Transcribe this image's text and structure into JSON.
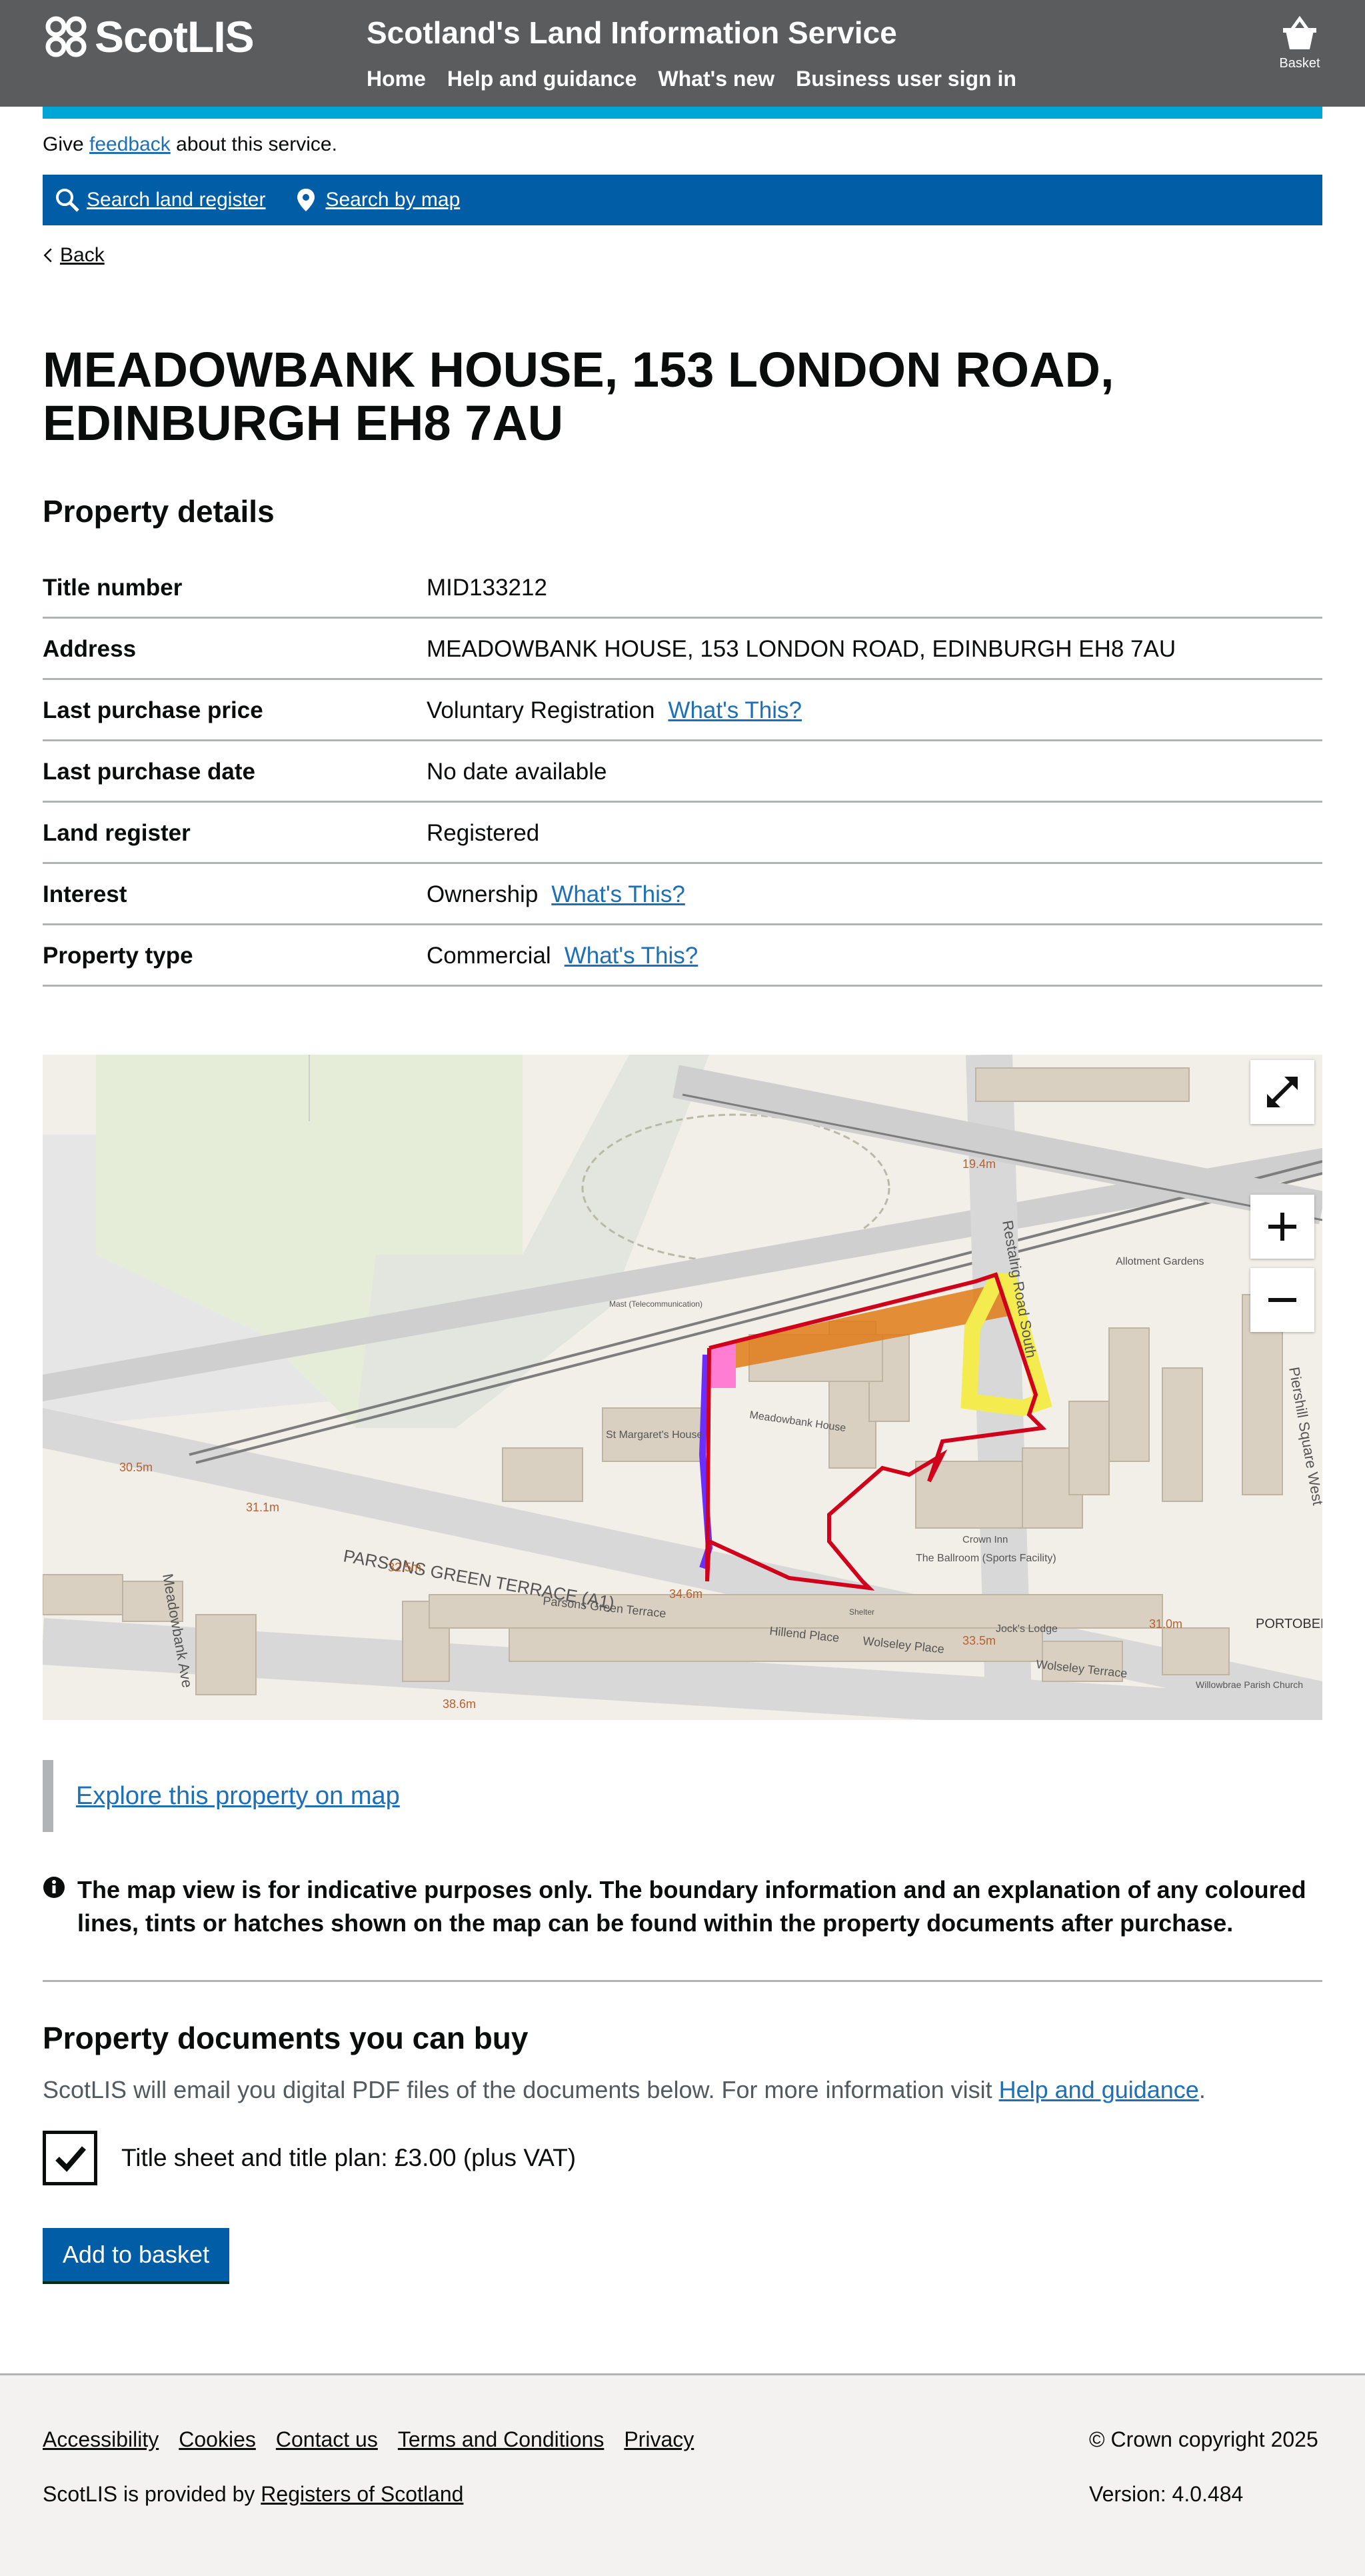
{
  "header": {
    "logo_text": "ScotLIS",
    "service_name": "Scotland's Land Information Service",
    "nav": [
      "Home",
      "Help and guidance",
      "What's new",
      "Business user sign in"
    ],
    "basket_label": "Basket"
  },
  "feedback": {
    "prefix": "Give ",
    "link": "feedback",
    "suffix": " about this service."
  },
  "search": {
    "land_register": "Search land register",
    "by_map": "Search by map"
  },
  "back_label": "Back",
  "page_title": "MEADOWBANK HOUSE, 153 LONDON ROAD, EDINBURGH EH8 7AU",
  "property_details": {
    "heading": "Property details",
    "rows": [
      {
        "key": "Title number",
        "value": "MID133212"
      },
      {
        "key": "Address",
        "value": "MEADOWBANK HOUSE, 153 LONDON ROAD, EDINBURGH EH8 7AU"
      },
      {
        "key": "Last purchase price",
        "value": "Voluntary Registration",
        "link": "What's This?"
      },
      {
        "key": "Last purchase date",
        "value": "No date available"
      },
      {
        "key": "Land register",
        "value": "Registered"
      },
      {
        "key": "Interest",
        "value": "Ownership",
        "link": "What's This?"
      },
      {
        "key": "Property type",
        "value": "Commercial",
        "link": "What's This?"
      }
    ]
  },
  "map": {
    "labels": {
      "parsons_green_terrace_a1": "PARSONS GREEN TERRACE (A1)",
      "parsons_green_terrace": "Parsons Green Terrace",
      "restalrig_road_south": "Restalrig Road South",
      "piershill_square_west": "Piershill Square West",
      "meadowbank_ave": "Meadowbank Ave",
      "meadowbank_house": "Meadowbank House",
      "st_margarets_house": "St Margaret's House",
      "the_ballroom": "The Ballroom (Sports Facility)",
      "allotment_gardens": "Allotment Gardens",
      "hillend_place": "Hillend Place",
      "wolseley_place": "Wolseley Place",
      "wolseley_terrace": "Wolseley Terrace",
      "jocks_lodge": "Jock's Lodge",
      "portobello": "PORTOBEL",
      "willowbrae_church": "Willowbrae Parish Church",
      "crown_inn": "Crown Inn",
      "mast": "Mast (Telecommunication)",
      "shelter": "Shelter",
      "e_19_4": "19.4m",
      "e_30_5": "30.5m",
      "e_31_1": "31.1m",
      "e_32_5": "32.5m",
      "e_34_6": "34.6m",
      "e_33_5": "33.5m",
      "e_31_0": "31.0m",
      "e_38_6": "38.6m"
    },
    "controls": [
      "fullscreen-button",
      "zoom-in-button",
      "zoom-out-button"
    ]
  },
  "explore_link": "Explore this property on map",
  "notice": "The map view is for indicative purposes only. The boundary information and an explanation of any coloured lines, tints or hatches shown on the map can be found within the property documents after purchase.",
  "documents": {
    "heading": "Property documents you can buy",
    "intro_prefix": "ScotLIS will email you digital PDF files of the documents below. For more information visit ",
    "intro_link": "Help and guidance",
    "intro_suffix": ".",
    "item_label": "Title sheet and title plan: £3.00 (plus VAT)",
    "item_checked": true,
    "add_button": "Add to basket"
  },
  "footer": {
    "links": [
      "Accessibility",
      "Cookies",
      "Contact us",
      "Terms and Conditions",
      "Privacy"
    ],
    "provided_prefix": "ScotLIS is provided by ",
    "provided_link": "Registers of Scotland",
    "copyright": "© Crown copyright 2025",
    "version": "Version: 4.0.484"
  },
  "colors": {
    "header": "#5a5c5e",
    "cyan": "#00a7d6",
    "search_bar": "#015ea6",
    "link": "#1d70b8",
    "boundary": "#d0021b"
  }
}
